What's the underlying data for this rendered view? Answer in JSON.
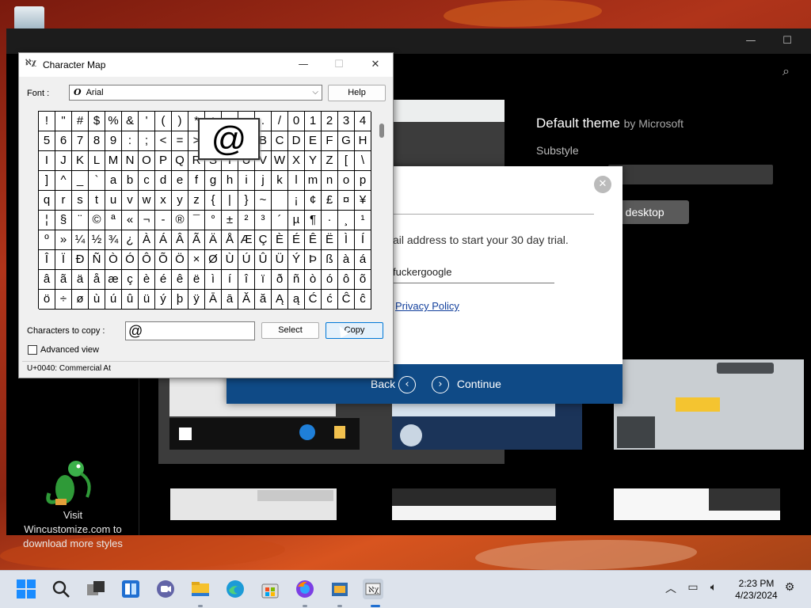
{
  "app_window": {
    "theme_title": "Default theme",
    "theme_by": "by Microsoft",
    "substyle_label": "Substyle",
    "apply_partial": "o desktop",
    "promo_text": "Visit\nWincustomize.com to\ndownload more styles"
  },
  "trial_dialog": {
    "prompt_partial": "ail address to start your 30 day trial.",
    "email_value": "fuckergoogle",
    "privacy_link": "Privacy Policy",
    "back_label": "Back",
    "continue_label": "Continue"
  },
  "charmap": {
    "title": "Character Map",
    "font_label": "Font :",
    "font_value": "Arial",
    "font_glyph": "O",
    "help_label": "Help",
    "zoom_char": "@",
    "characters": [
      "!",
      "\"",
      "#",
      "$",
      "%",
      "&",
      "'",
      "(",
      ")",
      "*",
      "+",
      ",",
      "-",
      ".",
      "/",
      "0",
      "1",
      "2",
      "3",
      "4",
      "5",
      "6",
      "7",
      "8",
      "9",
      ":",
      ";",
      "<",
      "=",
      ">",
      "?",
      "@",
      "A",
      "B",
      "C",
      "D",
      "E",
      "F",
      "G",
      "H",
      "I",
      "J",
      "K",
      "L",
      "M",
      "N",
      "O",
      "P",
      "Q",
      "R",
      "S",
      "T",
      "U",
      "V",
      "W",
      "X",
      "Y",
      "Z",
      "[",
      "\\",
      "]",
      "^",
      "_",
      "`",
      "a",
      "b",
      "c",
      "d",
      "e",
      "f",
      "g",
      "h",
      "i",
      "j",
      "k",
      "l",
      "m",
      "n",
      "o",
      "p",
      "q",
      "r",
      "s",
      "t",
      "u",
      "v",
      "w",
      "x",
      "y",
      "z",
      "{",
      "|",
      "}",
      "~",
      " ",
      "¡",
      "¢",
      "£",
      "¤",
      "¥",
      "¦",
      "§",
      "¨",
      "©",
      "ª",
      "«",
      "¬",
      "-",
      "®",
      "¯",
      "°",
      "±",
      "²",
      "³",
      "´",
      "µ",
      "¶",
      "·",
      "¸",
      "¹",
      "º",
      "»",
      "¼",
      "½",
      "¾",
      "¿",
      "À",
      "Á",
      "Â",
      "Ã",
      "Ä",
      "Å",
      "Æ",
      "Ç",
      "È",
      "É",
      "Ê",
      "Ë",
      "Ì",
      "Í",
      "Î",
      "Ï",
      "Ð",
      "Ñ",
      "Ò",
      "Ó",
      "Ô",
      "Õ",
      "Ö",
      "×",
      "Ø",
      "Ù",
      "Ú",
      "Û",
      "Ü",
      "Ý",
      "Þ",
      "ß",
      "à",
      "á",
      "â",
      "ã",
      "ä",
      "å",
      "æ",
      "ç",
      "è",
      "é",
      "ê",
      "ë",
      "ì",
      "í",
      "î",
      "ï",
      "ð",
      "ñ",
      "ò",
      "ó",
      "ô",
      "õ",
      "ö",
      "÷",
      "ø",
      "ù",
      "ú",
      "û",
      "ü",
      "ý",
      "þ",
      "ÿ",
      "Ā",
      "ā",
      "Ă",
      "ă",
      "Ą",
      "ą",
      "Ć",
      "ć",
      "Ĉ",
      "ĉ"
    ],
    "copy_label": "Characters to copy :",
    "copy_value": "@",
    "select_label": "Select",
    "copy_button_label": "Copy",
    "advanced_label": "Advanced view",
    "status_text": "U+0040: Commercial At"
  },
  "taskbar": {
    "time": "2:23 PM",
    "date": "4/23/2024",
    "icons": [
      "start-icon",
      "search-icon",
      "task-view-icon",
      "widgets-icon",
      "teams-chat-icon",
      "file-explorer-icon",
      "edge-icon",
      "store-icon",
      "firefox-icon",
      "app-icon",
      "character-map-icon"
    ]
  },
  "colors": {
    "accent_blue": "#0f4a86",
    "desktop_red": "#b0341a"
  }
}
